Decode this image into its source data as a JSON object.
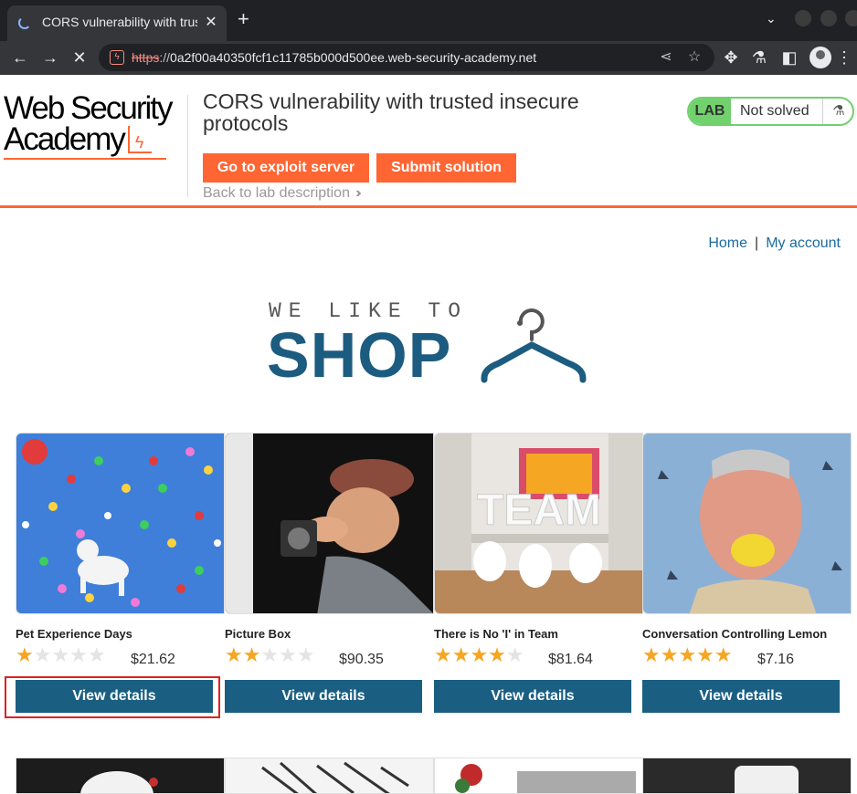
{
  "browser": {
    "tab_title": "CORS vulnerability with trusted insecure protocols",
    "tab_close": "✕",
    "new_tab": "+",
    "url_scheme": "https",
    "url_sep": "://",
    "url_host": "0a2f00a40350fcf1c11785b000d500ee.web-security-academy.net"
  },
  "lab": {
    "logo_line1": "Web Security",
    "logo_line2": "Academy",
    "title": "CORS vulnerability with trusted insecure protocols",
    "exploit_button": "Go to exploit server",
    "submit_button": "Submit solution",
    "back_link": "Back to lab description",
    "status_tag": "LAB",
    "status_text": "Not solved"
  },
  "nav": {
    "home": "Home",
    "separator": "|",
    "my_account": "My account"
  },
  "hero": {
    "small": "WE LIKE TO",
    "big": "SHOP"
  },
  "products": [
    {
      "name": "Pet Experience Days",
      "rating": 1,
      "price": "$21.62",
      "button": "View details"
    },
    {
      "name": "Picture Box",
      "rating": 2,
      "price": "$90.35",
      "button": "View details"
    },
    {
      "name": "There is No 'I' in Team",
      "rating": 4,
      "price": "$81.64",
      "button": "View details"
    },
    {
      "name": "Conversation Controlling Lemon",
      "rating": 5,
      "price": "$7.16",
      "button": "View details"
    }
  ],
  "colors": {
    "accent_orange": "#ff6633",
    "brand_blue": "#1a5f82",
    "lab_green": "#70d16d",
    "highlight_red": "#e02020"
  }
}
